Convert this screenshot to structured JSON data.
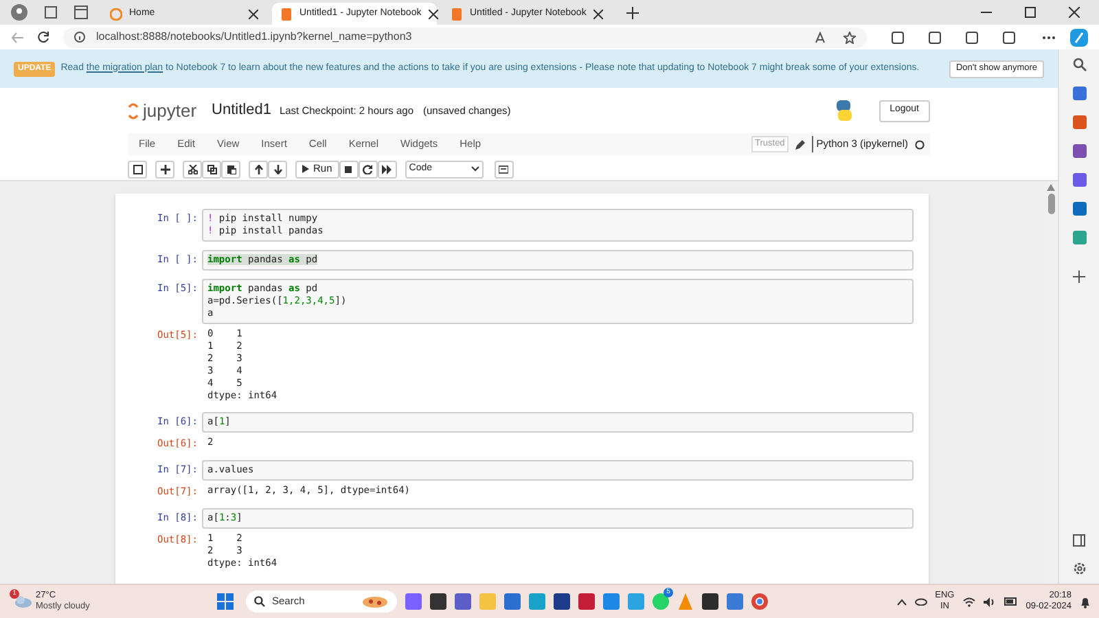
{
  "browser": {
    "tabs": [
      {
        "title": "Home",
        "kind": "edge",
        "selected": false
      },
      {
        "title": "Untitled1 - Jupyter Notebook",
        "kind": "jupyter",
        "selected": true
      },
      {
        "title": "Untitled - Jupyter Notebook",
        "kind": "jupyter",
        "selected": false
      }
    ],
    "url": "localhost:8888/notebooks/Untitled1.ipynb?kernel_name=python3"
  },
  "banner": {
    "badge": "UPDATE",
    "pre": "Read",
    "link": "the migration plan",
    "post": "to Notebook 7 to learn about the new features and the actions to take if you are using extensions - Please note that updating to Notebook 7 might break some of your extensions.",
    "button": "Don't show anymore"
  },
  "header": {
    "logo": "jupyter",
    "notebook_name": "Untitled1",
    "checkpoint": "Last Checkpoint: 2 hours ago",
    "unsaved": "(unsaved changes)",
    "logout": "Logout"
  },
  "menu": [
    "File",
    "Edit",
    "View",
    "Insert",
    "Cell",
    "Kernel",
    "Widgets",
    "Help"
  ],
  "kernel": {
    "trusted": "Trusted",
    "name": "Python 3 (ipykernel)",
    "busy": false
  },
  "toolbar": {
    "run": "Run",
    "cell_type": "Code"
  },
  "cells": [
    {
      "prompt": "In [ ]:",
      "match_highlight": false,
      "lines": [
        [
          {
            "t": "!",
            "kind": "bang"
          },
          {
            "t": " pip install numpy",
            "kind": "plain"
          }
        ],
        [
          {
            "t": "!",
            "kind": "bang"
          },
          {
            "t": " pip install pandas",
            "kind": "plain"
          }
        ]
      ]
    },
    {
      "prompt": "In [ ]:",
      "match_highlight": true,
      "lines": [
        [
          {
            "t": "import",
            "kind": "keyword"
          },
          {
            "t": " pandas ",
            "kind": "plain"
          },
          {
            "t": "as",
            "kind": "keyword"
          },
          {
            "t": " pd",
            "kind": "plain"
          }
        ]
      ]
    },
    {
      "prompt": "In [5]:",
      "match_highlight": false,
      "lines": [
        [
          {
            "t": "import",
            "kind": "keyword"
          },
          {
            "t": " pandas ",
            "kind": "plain"
          },
          {
            "t": "as",
            "kind": "keyword"
          },
          {
            "t": " pd",
            "kind": "plain"
          }
        ],
        [
          {
            "t": "a=pd.Series([",
            "kind": "plain"
          },
          {
            "t": "1,2,3,4,5",
            "kind": "number"
          },
          {
            "t": "])",
            "kind": "plain"
          }
        ],
        [
          {
            "t": "a",
            "kind": "plain"
          }
        ]
      ],
      "output": {
        "prompt": "Out[5]:",
        "lines": [
          "0    1",
          "1    2",
          "2    3",
          "3    4",
          "4    5",
          "dtype: int64"
        ]
      }
    },
    {
      "prompt": "In [6]:",
      "match_highlight": false,
      "lines": [
        [
          {
            "t": "a[",
            "kind": "plain"
          },
          {
            "t": "1",
            "kind": "number"
          },
          {
            "t": "]",
            "kind": "plain"
          }
        ]
      ],
      "output": {
        "prompt": "Out[6]:",
        "lines": [
          "2"
        ]
      }
    },
    {
      "prompt": "In [7]:",
      "match_highlight": false,
      "lines": [
        [
          {
            "t": "a.values",
            "kind": "plain"
          }
        ]
      ],
      "output": {
        "prompt": "Out[7]:",
        "lines": [
          "array([1, 2, 3, 4, 5], dtype=int64)"
        ]
      }
    },
    {
      "prompt": "In [8]:",
      "match_highlight": false,
      "lines": [
        [
          {
            "t": "a[",
            "kind": "plain"
          },
          {
            "t": "1",
            "kind": "number"
          },
          {
            "t": ":",
            "kind": "plain"
          },
          {
            "t": "3",
            "kind": "number"
          },
          {
            "t": "]",
            "kind": "plain"
          }
        ]
      ],
      "output": {
        "prompt": "Out[8]:",
        "lines": [
          "1    2",
          "2    3",
          "dtype: int64"
        ]
      }
    }
  ],
  "taskbar": {
    "weather_badge": "1",
    "temperature": "27°C",
    "condition": "Mostly cloudy",
    "search": "Search",
    "chat_badge": "5",
    "language": "ENG",
    "region": "IN",
    "time": "20:18",
    "date": "09-02-2024"
  }
}
